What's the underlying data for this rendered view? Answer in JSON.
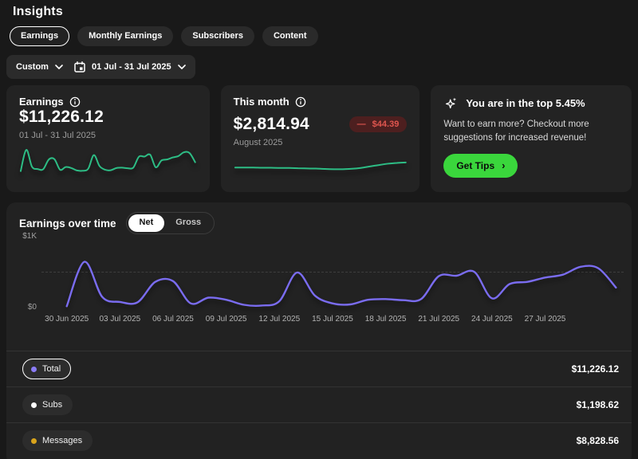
{
  "header": {
    "title": "Insights"
  },
  "tabs": [
    {
      "label": "Earnings",
      "active": true
    },
    {
      "label": "Monthly Earnings",
      "active": false
    },
    {
      "label": "Subscribers",
      "active": false
    },
    {
      "label": "Content",
      "active": false
    }
  ],
  "filters": {
    "preset": "Custom",
    "range": "01 Jul - 31 Jul 2025"
  },
  "cards": {
    "earnings": {
      "title": "Earnings",
      "amount": "$11,226.12",
      "period": "01 Jul - 31 Jul 2025"
    },
    "this_month": {
      "title": "This month",
      "amount": "$2,814.94",
      "period": "August 2025",
      "badge_sign": "—",
      "badge_amount": "$44.39"
    },
    "tips": {
      "title": "You are in the top 5.45%",
      "body": "Want to earn more? Checkout more suggestions for increased revenue!",
      "button_label": "Get Tips",
      "button_chevron": "›"
    }
  },
  "chart_section": {
    "title": "Earnings over time",
    "toggle": {
      "options": [
        "Net",
        "Gross"
      ],
      "active": "Net"
    }
  },
  "legend": {
    "rows": [
      {
        "label": "Total",
        "value": "$11,226.12",
        "dot_color": "#8b7cf7",
        "selected": true
      },
      {
        "label": "Subs",
        "value": "$1,198.62",
        "dot_color": "#ffffff",
        "selected": false
      },
      {
        "label": "Messages",
        "value": "$8,828.56",
        "dot_color": "#d9a41c",
        "selected": false
      }
    ]
  },
  "colors": {
    "accent_green": "#3ad63c",
    "sparkline_green": "#2dbd85",
    "chart_purple": "#7a6cf0",
    "badge_bg": "#4d1f1f",
    "badge_text": "#e0564f"
  },
  "chart_data": [
    {
      "id": "earnings_over_time",
      "type": "line",
      "title": "Earnings over time",
      "series_name": "Net",
      "x_tick_labels": [
        "30 Jun 2025",
        "03 Jul 2025",
        "06 Jul 2025",
        "09 Jul 2025",
        "12 Jul 2025",
        "15 Jul 2025",
        "18 Jul 2025",
        "21 Jul 2025",
        "24 Jul 2025",
        "27 Jul 2025"
      ],
      "x_tick_day_index": [
        0,
        3,
        6,
        9,
        12,
        15,
        18,
        21,
        24,
        27
      ],
      "x_range_days": 31,
      "y_tick_labels": [
        "$0",
        "$1K"
      ],
      "ylim": [
        0,
        1000
      ],
      "gridline_y": 500,
      "legend_position": "bottom",
      "line_color": "#7a6cf0",
      "values": [
        30,
        650,
        160,
        90,
        85,
        370,
        380,
        70,
        150,
        120,
        50,
        40,
        100,
        500,
        180,
        70,
        55,
        120,
        130,
        115,
        130,
        450,
        455,
        510,
        140,
        340,
        370,
        430,
        470,
        580,
        560,
        290
      ],
      "totals": {
        "Total": 11226.12,
        "Subs": 1198.62,
        "Messages": 8828.56
      }
    },
    {
      "id": "earnings_sparkline",
      "type": "line",
      "card": "Earnings",
      "line_color": "#2dbd85",
      "ylim": [
        0,
        700
      ],
      "values": [
        30,
        650,
        160,
        90,
        85,
        370,
        380,
        70,
        150,
        120,
        50,
        40,
        100,
        500,
        180,
        70,
        55,
        120,
        130,
        115,
        130,
        450,
        455,
        510,
        140,
        340,
        370,
        430,
        470,
        580,
        560,
        290
      ]
    },
    {
      "id": "this_month_sparkline",
      "type": "line",
      "card": "This month",
      "line_color": "#2dbd85",
      "ylim": [
        0,
        100
      ],
      "values": [
        40,
        40,
        40,
        39,
        39,
        38,
        38,
        37,
        36,
        35,
        33,
        32,
        32,
        34,
        38,
        45,
        52,
        58,
        62,
        64
      ]
    }
  ]
}
